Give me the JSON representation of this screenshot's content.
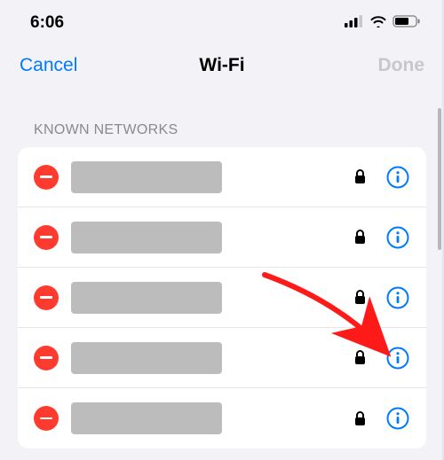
{
  "status": {
    "time": "6:06"
  },
  "nav": {
    "cancel": "Cancel",
    "title": "Wi-Fi",
    "done": "Done"
  },
  "section": {
    "header": "KNOWN NETWORKS"
  },
  "networks": [
    {
      "name": "",
      "secured": true
    },
    {
      "name": "",
      "secured": true
    },
    {
      "name": "",
      "secured": true
    },
    {
      "name": "",
      "secured": true
    },
    {
      "name": "",
      "secured": true
    }
  ],
  "colors": {
    "accent": "#007aff",
    "delete": "#ff3b30",
    "disabled": "#c7c7cc",
    "arrow": "#ff1a1a"
  }
}
